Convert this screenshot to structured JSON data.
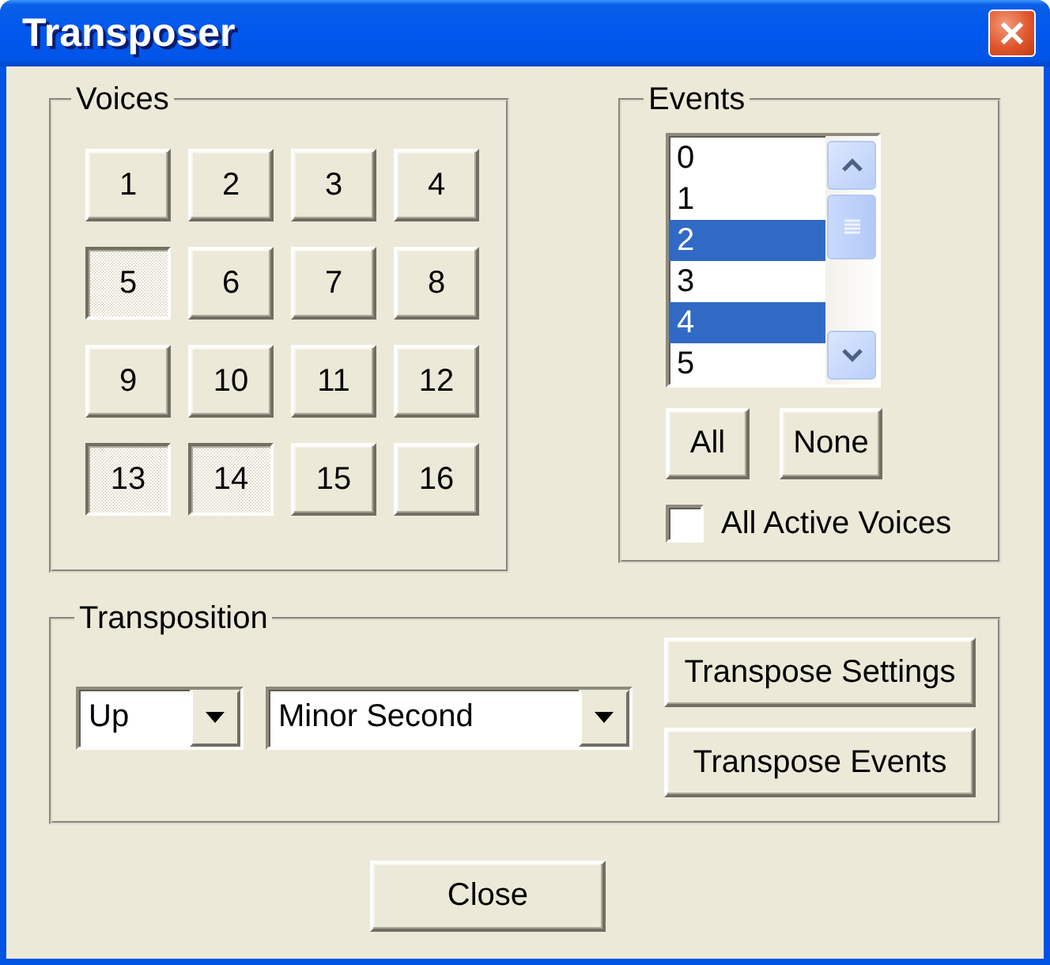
{
  "window": {
    "title": "Transposer"
  },
  "voices": {
    "title": "Voices",
    "buttons": [
      {
        "label": "1",
        "selected": false
      },
      {
        "label": "2",
        "selected": false
      },
      {
        "label": "3",
        "selected": false
      },
      {
        "label": "4",
        "selected": false
      },
      {
        "label": "5",
        "selected": true
      },
      {
        "label": "6",
        "selected": false
      },
      {
        "label": "7",
        "selected": false
      },
      {
        "label": "8",
        "selected": false
      },
      {
        "label": "9",
        "selected": false
      },
      {
        "label": "10",
        "selected": false
      },
      {
        "label": "11",
        "selected": false
      },
      {
        "label": "12",
        "selected": false
      },
      {
        "label": "13",
        "selected": true
      },
      {
        "label": "14",
        "selected": true
      },
      {
        "label": "15",
        "selected": false
      },
      {
        "label": "16",
        "selected": false
      }
    ]
  },
  "events": {
    "title": "Events",
    "items": [
      {
        "label": "0",
        "selected": false
      },
      {
        "label": "1",
        "selected": false
      },
      {
        "label": "2",
        "selected": true
      },
      {
        "label": "3",
        "selected": false
      },
      {
        "label": "4",
        "selected": true
      },
      {
        "label": "5",
        "selected": false
      }
    ],
    "buttons": [
      {
        "label": "All"
      },
      {
        "label": "None"
      }
    ],
    "checkbox": {
      "label": "All Active Voices",
      "checked": false
    }
  },
  "transposition": {
    "title": "Transposition",
    "direction": {
      "value": "Up"
    },
    "interval": {
      "value": "Minor Second"
    },
    "buttons": [
      {
        "label": "Transpose Settings"
      },
      {
        "label": "Transpose Events"
      }
    ]
  },
  "footer": {
    "button": "Close"
  }
}
